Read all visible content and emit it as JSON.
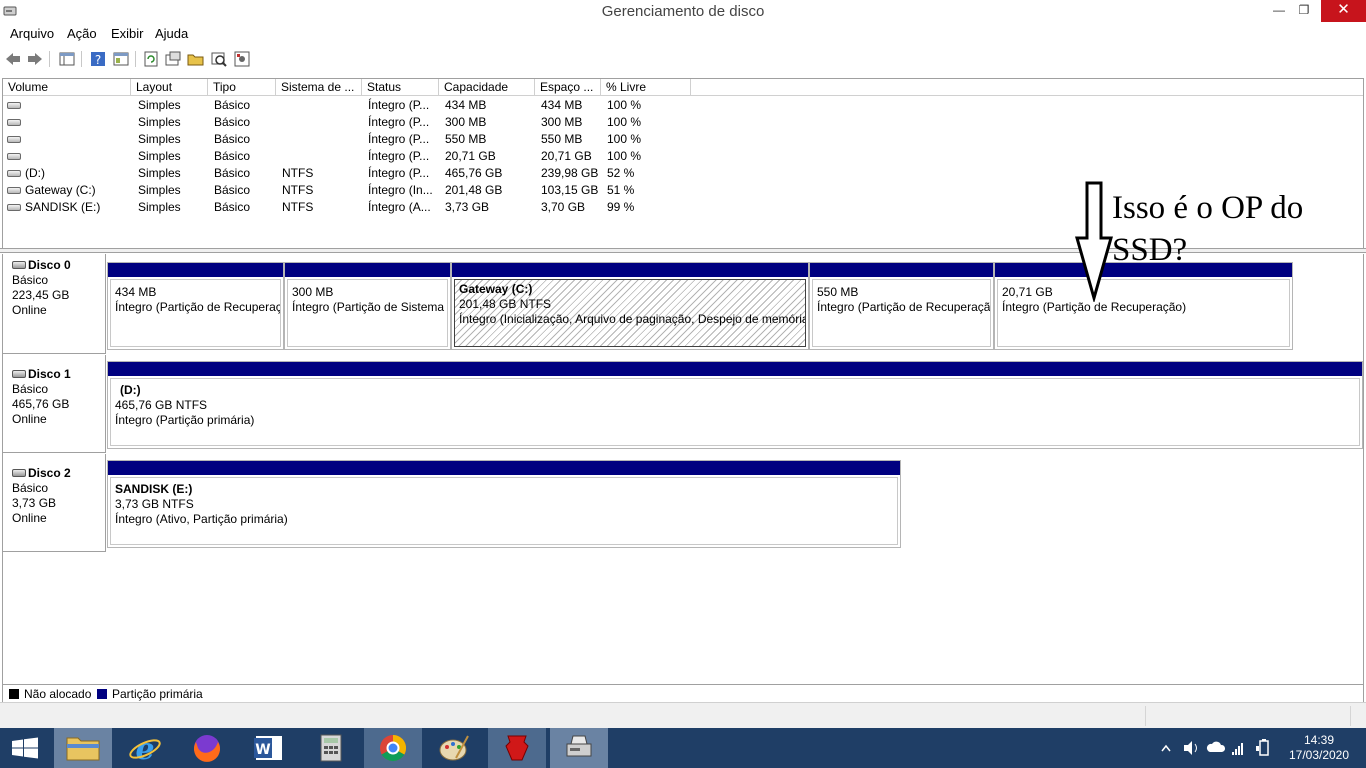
{
  "window": {
    "title": "Gerenciamento de disco",
    "minimize": "—",
    "maximize": "❐",
    "close": "✕"
  },
  "menu": [
    "Arquivo",
    "Ação",
    "Exibir",
    "Ajuda"
  ],
  "toolbar": {
    "icons": [
      "back-arrow-icon",
      "forward-arrow-icon",
      "console-tree-icon",
      "help-icon",
      "properties-list-icon",
      "refresh-icon",
      "rescan-icon",
      "open-folder-icon",
      "explore-icon",
      "settings-icon"
    ]
  },
  "volume_list": {
    "columns": [
      "Volume",
      "Layout",
      "Tipo",
      "Sistema de ...",
      "Status",
      "Capacidade",
      "Espaço ...",
      "% Livre"
    ],
    "rows": [
      [
        "",
        "Simples",
        "Básico",
        "",
        "Íntegro (P...",
        "434 MB",
        "434 MB",
        "100 %"
      ],
      [
        "",
        "Simples",
        "Básico",
        "",
        "Íntegro (P...",
        "300 MB",
        "300 MB",
        "100 %"
      ],
      [
        "",
        "Simples",
        "Básico",
        "",
        "Íntegro (P...",
        "550 MB",
        "550 MB",
        "100 %"
      ],
      [
        "",
        "Simples",
        "Básico",
        "",
        "Íntegro (P...",
        "20,71 GB",
        "20,71 GB",
        "100 %"
      ],
      [
        "(D:)",
        "Simples",
        "Básico",
        "NTFS",
        "Íntegro (P...",
        "465,76 GB",
        "239,98 GB",
        "52 %"
      ],
      [
        "Gateway (C:)",
        "Simples",
        "Básico",
        "NTFS",
        "Íntegro (In...",
        "201,48 GB",
        "103,15 GB",
        "51 %"
      ],
      [
        "SANDISK (E:)",
        "Simples",
        "Básico",
        "NTFS",
        "Íntegro (A...",
        "3,73 GB",
        "3,70 GB",
        "99 %"
      ]
    ]
  },
  "disks": [
    {
      "name": "Disco 0",
      "type": "Básico",
      "size": "223,45 GB",
      "state": "Online",
      "partitions": [
        {
          "title": "",
          "size": "434 MB",
          "status": "Íntegro (Partição de Recuperação)"
        },
        {
          "title": "",
          "size": "300 MB",
          "status": "Íntegro (Partição de Sistema EFI)"
        },
        {
          "title": "Gateway  (C:)",
          "size": "201,48 GB NTFS",
          "status": "Íntegro (Inicialização, Arquivo de paginação, Despejo de memória, Partição primária)"
        },
        {
          "title": "",
          "size": "550 MB",
          "status": "Íntegro (Partição de Recuperação)"
        },
        {
          "title": "",
          "size": "20,71 GB",
          "status": "Íntegro (Partição de Recuperação)"
        }
      ]
    },
    {
      "name": "Disco 1",
      "type": "Básico",
      "size": "465,76 GB",
      "state": "Online",
      "partitions": [
        {
          "title": "(D:)",
          "size": "465,76 GB NTFS",
          "status": "Íntegro (Partição primária)"
        }
      ]
    },
    {
      "name": "Disco 2",
      "type": "Básico",
      "size": "3,73 GB",
      "state": "Online",
      "partitions": [
        {
          "title": "SANDISK  (E:)",
          "size": "3,73 GB NTFS",
          "status": "Íntegro (Ativo, Partição primária)"
        }
      ]
    }
  ],
  "legend": {
    "unallocated": "Não alocado",
    "primary": "Partição primária",
    "colors": {
      "unallocated": "#000000",
      "primary": "#000080"
    }
  },
  "annotation": {
    "line1": "Isso é o OP do",
    "line2": "SSD?"
  },
  "taskbar": {
    "apps": [
      "start-button",
      "file-explorer",
      "internet-explorer",
      "firefox",
      "word",
      "calculator",
      "chrome",
      "paint",
      "hyperx-app",
      "disk-management"
    ],
    "clock_time": "14:39",
    "clock_date": "17/03/2020"
  }
}
